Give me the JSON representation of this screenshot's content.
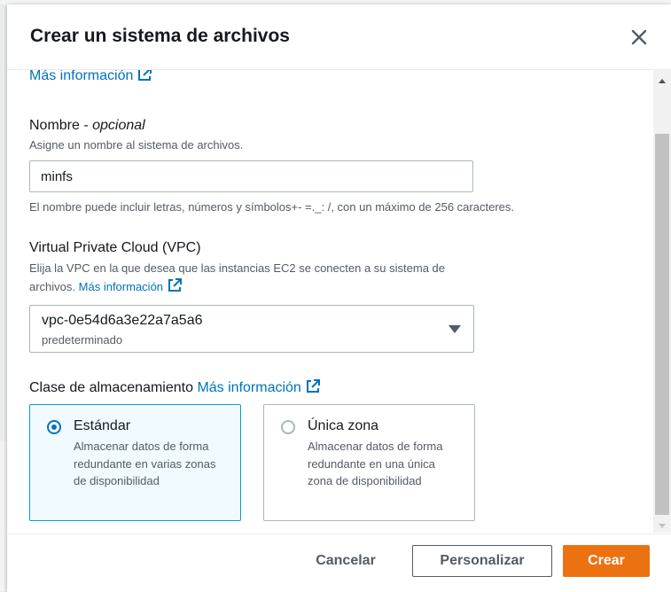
{
  "dialog": {
    "title": "Crear un sistema de archivos",
    "close_icon": "close-icon"
  },
  "top_link": {
    "label": "Más información",
    "icon": "external-link-icon"
  },
  "name_field": {
    "label": "Nombre",
    "label_suffix": " - ",
    "optional": "opcional",
    "description": "Asigne un nombre al sistema de archivos.",
    "value": "minfs",
    "constraint": "El nombre puede incluir letras, números y símbolos+- =._: /, con un máximo de 256 caracteres."
  },
  "vpc_field": {
    "label": "Virtual Private Cloud (VPC)",
    "description_line1": "Elija la VPC en la que desea que las instancias EC2 se conecten a su sistema de",
    "description_line2": "archivos.",
    "info_link": "Más información",
    "selected_value": "vpc-0e54d6a3e22a7a5a6",
    "selected_sub": "predeterminado",
    "caret_icon": "caret-down-icon"
  },
  "storage_class": {
    "label": "Clase de almacenamiento",
    "info_link": "Más información",
    "options": [
      {
        "title": "Estándar",
        "description": "Almacenar datos de forma redundante en varias zonas de disponibilidad",
        "selected": true
      },
      {
        "title": "Única zona",
        "description": "Almacenar datos de forma redundante en una única zona de disponibilidad",
        "selected": false
      }
    ]
  },
  "footer": {
    "cancel": "Cancelar",
    "customize": "Personalizar",
    "create": "Crear"
  },
  "colors": {
    "link": "#0073bb",
    "primary": "#ec7211",
    "selected_tile_bg": "#f1faff",
    "selected_tile_border": "#00a1c9"
  }
}
